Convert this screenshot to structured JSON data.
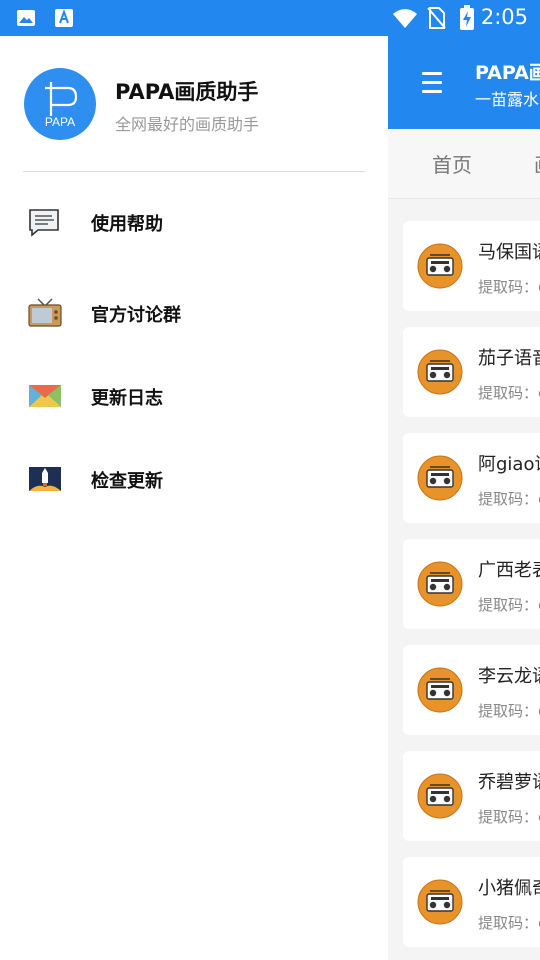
{
  "status_bar": {
    "time": "2:05",
    "left_icons": [
      "image-icon",
      "text-a-icon"
    ],
    "right_icons": [
      "wifi-icon",
      "no-sim-icon",
      "battery-charging-icon"
    ]
  },
  "drawer": {
    "app_name": "PAPA画质助手",
    "app_desc": "全网最好的画质助手",
    "logo_text": "PAPA",
    "items": [
      {
        "label": "使用帮助",
        "icon": "help-doc-icon"
      },
      {
        "label": "官方讨论群",
        "icon": "tv-icon"
      },
      {
        "label": "更新日志",
        "icon": "mail-icon"
      },
      {
        "label": "检查更新",
        "icon": "rocket-icon"
      }
    ]
  },
  "main": {
    "title": "PAPA画",
    "subtitle": "一苗露水",
    "tabs": [
      "首页",
      "画"
    ],
    "cards": [
      {
        "title": "马保国语",
        "sub": "提取码：c"
      },
      {
        "title": "茄子语音",
        "sub": "提取码：c"
      },
      {
        "title": "阿giao语",
        "sub": "提取码：c"
      },
      {
        "title": "广西老表",
        "sub": "提取码：c"
      },
      {
        "title": "李云龙语",
        "sub": "提取码：c"
      },
      {
        "title": "乔碧萝语",
        "sub": "提取码：c"
      },
      {
        "title": "小猪佩奇",
        "sub": "提取码：c"
      }
    ]
  },
  "colors": {
    "primary": "#2387f0",
    "card_icon": "#e8922a"
  }
}
